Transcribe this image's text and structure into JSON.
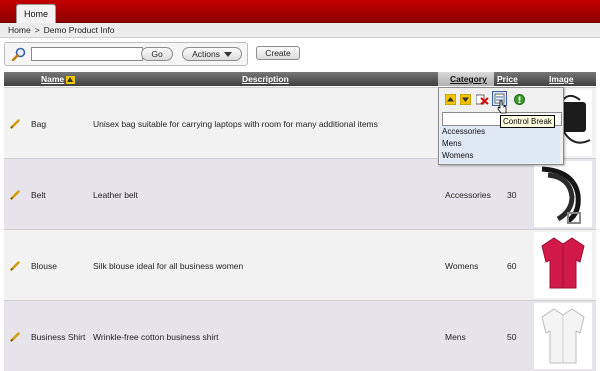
{
  "header": {
    "tab_home": "Home"
  },
  "breadcrumb": {
    "home": "Home",
    "separator": ">",
    "current": "Demo Product Info"
  },
  "toolbar": {
    "search_value": "",
    "go_label": "Go",
    "actions_label": "Actions",
    "create_label": "Create"
  },
  "table": {
    "columns": {
      "name": "Name",
      "description": "Description",
      "category": "Category",
      "price": "Price",
      "image": "Image"
    },
    "rows": [
      {
        "name": "Bag",
        "description": "Unisex bag suitable for carrying laptops with room for many additional items",
        "category": "",
        "price": "",
        "image": "bag-image"
      },
      {
        "name": "Belt",
        "description": "Leather belt",
        "category": "Accessories",
        "price": "30",
        "image": "belt-image"
      },
      {
        "name": "Blouse",
        "description": "Silk blouse ideal for all business women",
        "category": "Womens",
        "price": "60",
        "image": "blouse-image"
      },
      {
        "name": "Business Shirt",
        "description": "Wrinkle-free cotton business shirt",
        "category": "Mens",
        "price": "50",
        "image": "shirt-image"
      }
    ]
  },
  "column_menu": {
    "icons": [
      "sort-ascending-icon",
      "sort-descending-icon",
      "hide-column-icon",
      "control-break-icon",
      "help-icon"
    ],
    "filter_value": "",
    "options": [
      "Accessories",
      "Mens",
      "Womens"
    ],
    "tooltip": "Control Break"
  },
  "colors": {
    "header_red": "#c40000",
    "row_alt": "#e6e4ea",
    "row_plain": "#f2f2f2"
  }
}
